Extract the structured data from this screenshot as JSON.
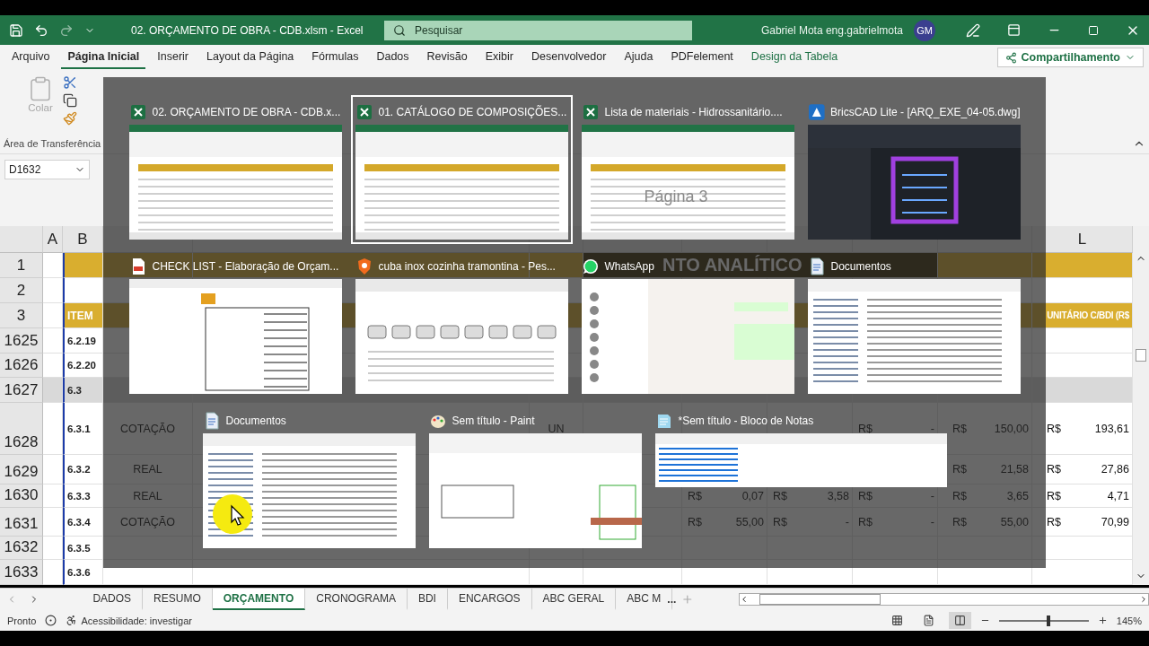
{
  "title_bar": {
    "title": "02. ORÇAMENTO DE OBRA - CDB.xlsm  -  Excel",
    "search": {
      "placeholder": "Pesquisar"
    },
    "user": "Gabriel Mota eng.gabrielmota",
    "avatar": "GM"
  },
  "ribbon_tabs": [
    {
      "label": "Arquivo",
      "selected": false,
      "contextual": false
    },
    {
      "label": "Página Inicial",
      "selected": true,
      "contextual": false
    },
    {
      "label": "Inserir",
      "selected": false,
      "contextual": false
    },
    {
      "label": "Layout da Página",
      "selected": false,
      "contextual": false
    },
    {
      "label": "Fórmulas",
      "selected": false,
      "contextual": false
    },
    {
      "label": "Dados",
      "selected": false,
      "contextual": false
    },
    {
      "label": "Revisão",
      "selected": false,
      "contextual": false
    },
    {
      "label": "Exibir",
      "selected": false,
      "contextual": false
    },
    {
      "label": "Desenvolvedor",
      "selected": false,
      "contextual": false
    },
    {
      "label": "Ajuda",
      "selected": false,
      "contextual": false
    },
    {
      "label": "PDFelement",
      "selected": false,
      "contextual": false
    },
    {
      "label": "Design da Tabela",
      "selected": false,
      "contextual": true
    }
  ],
  "share_button": "Compartilhamento",
  "clipboard": {
    "paste": "Colar",
    "paste_disabled": true,
    "group_label": "Área de Transferência"
  },
  "sheet": {
    "name_box": "D1632",
    "columns": [
      "A",
      "B",
      "L"
    ],
    "title_rows": [
      {
        "number": "1"
      },
      {
        "number": "2"
      },
      {
        "number": "3"
      }
    ],
    "title": "NTO ANALÍTICO",
    "item_header": "ITEM",
    "price_header": "UNITÁRIO C/BDI (R$",
    "rows": [
      {
        "number": "1625",
        "item": "6.2.19",
        "kind": "item"
      },
      {
        "number": "1626",
        "item": "6.2.20",
        "kind": "item"
      },
      {
        "number": "1627",
        "item": "6.3",
        "kind": "group"
      },
      {
        "number": "1628",
        "item": "6.3.1",
        "kind": "item",
        "type": "COTAÇÃO",
        "unit": "UN",
        "amounts": {
          "column_9": {
            "currency": "R$",
            "value": "-"
          },
          "column_10": {
            "currency": "R$",
            "value": "150,00"
          },
          "column_11": {
            "currency": "R$",
            "value": "193,61"
          }
        }
      },
      {
        "number": "1629",
        "item": "6.3.2",
        "kind": "item",
        "type": "REAL",
        "amounts": {
          "column_10": {
            "currency": "R$",
            "value": "21,58"
          },
          "column_11": {
            "currency": "R$",
            "value": "27,86"
          }
        }
      },
      {
        "number": "1630",
        "item": "6.3.3",
        "kind": "item",
        "type": "REAL",
        "amounts": {
          "column_7": {
            "currency": "R$",
            "value": "0,07"
          },
          "column_8": {
            "currency": "R$",
            "value": "3,58"
          },
          "column_9": {
            "currency": "R$",
            "value": "-"
          },
          "column_10": {
            "currency": "R$",
            "value": "3,65"
          },
          "column_11": {
            "currency": "R$",
            "value": "4,71"
          }
        }
      },
      {
        "number": "1631",
        "item": "6.3.4",
        "kind": "item",
        "type": "COTAÇÃO",
        "amounts": {
          "column_7": {
            "currency": "R$",
            "value": "55,00"
          },
          "column_8": {
            "currency": "R$",
            "value": "-"
          },
          "column_9": {
            "currency": "R$",
            "value": "-"
          },
          "column_10": {
            "currency": "R$",
            "value": "55,00"
          },
          "column_11": {
            "currency": "R$",
            "value": "70,99"
          }
        }
      },
      {
        "number": "1632",
        "item": "6.3.5",
        "kind": "item"
      },
      {
        "number": "1633",
        "item": "6.3.6",
        "kind": "item"
      }
    ]
  },
  "task_switcher": {
    "rows": [
      [
        {
          "title": "02. ORÇAMENTO DE OBRA - CDB.x...",
          "kind": "spreadsheet",
          "selected": false
        },
        {
          "title": "01. CATÁLOGO DE COMPOSIÇÕES...",
          "kind": "spreadsheet",
          "selected": true
        },
        {
          "title": "Lista de materiais - Hidrossanitário....",
          "kind": "spreadsheet",
          "selected": false,
          "preview_label": "Página 3"
        },
        {
          "title": "BricsCAD Lite - [ARQ_EXE_04-05.dwg]",
          "kind": "cad",
          "selected": false
        }
      ],
      [
        {
          "title": "CHECK LIST - Elaboração de Orçam...",
          "kind": "pdf",
          "selected": false
        },
        {
          "title": "cuba inox cozinha tramontina - Pes...",
          "kind": "browser",
          "selected": false
        },
        {
          "title": "WhatsApp",
          "kind": "chat",
          "selected": false
        },
        {
          "title": "Documentos",
          "kind": "folder",
          "selected": false
        }
      ],
      [
        {
          "title": "Documentos",
          "kind": "folder",
          "selected": false
        },
        {
          "title": "Sem título - Paint",
          "kind": "paint",
          "selected": false
        },
        {
          "title": "*Sem título - Bloco de Notas",
          "kind": "notepad",
          "selected": false
        }
      ]
    ]
  },
  "sheet_tabs": [
    {
      "label": "DADOS",
      "selected": false
    },
    {
      "label": "RESUMO",
      "selected": false
    },
    {
      "label": "ORÇAMENTO",
      "selected": true
    },
    {
      "label": "CRONOGRAMA",
      "selected": false
    },
    {
      "label": "BDI",
      "selected": false
    },
    {
      "label": "ENCARGOS",
      "selected": false
    },
    {
      "label": "ABC GERAL",
      "selected": false
    },
    {
      "label": "ABC M",
      "selected": false
    }
  ],
  "more_tabs": "...",
  "status_bar": {
    "status": "Pronto",
    "accessibility": "Acessibilidade: investigar",
    "zoom": {
      "level": 0.55,
      "reading": "145%"
    }
  }
}
